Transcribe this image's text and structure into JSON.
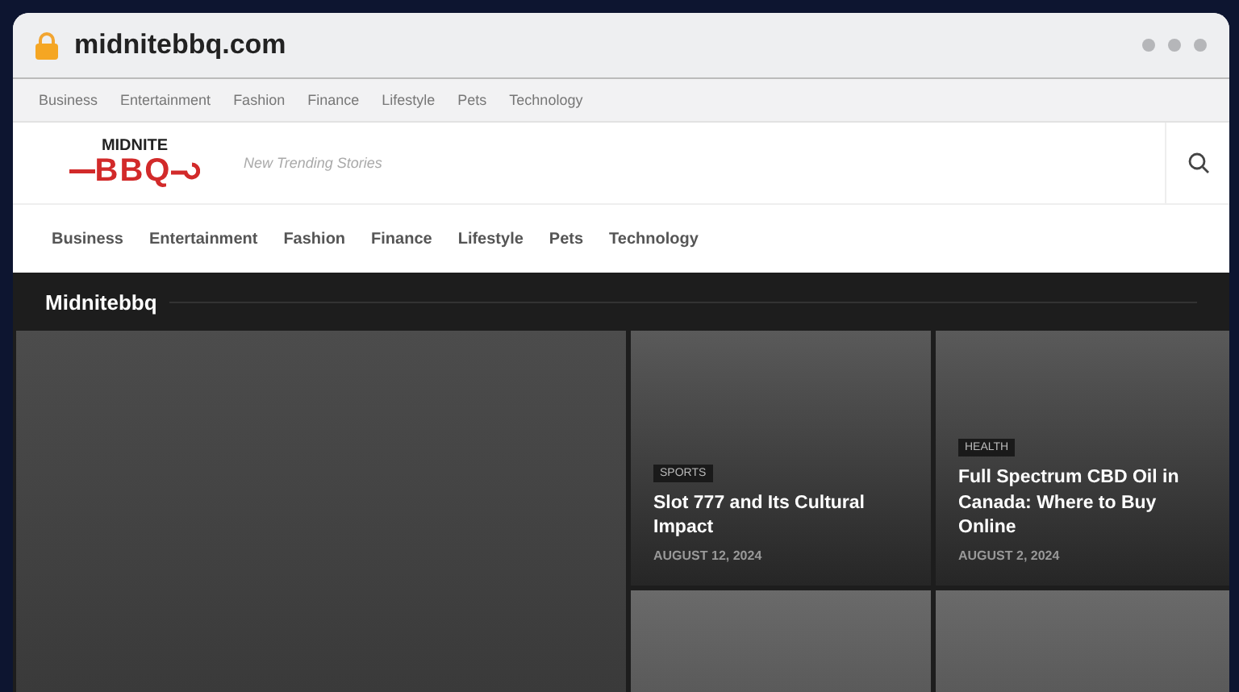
{
  "browser": {
    "address": "midnitebbq.com"
  },
  "top_nav": [
    "Business",
    "Entertainment",
    "Fashion",
    "Finance",
    "Lifestyle",
    "Pets",
    "Technology"
  ],
  "header": {
    "logo_top": "MIDNITE",
    "logo_main": "BBQ",
    "tagline": "New Trending Stories"
  },
  "main_nav": [
    "Business",
    "Entertainment",
    "Fashion",
    "Finance",
    "Lifestyle",
    "Pets",
    "Technology"
  ],
  "section": {
    "title": "Midnitebbq"
  },
  "posts": [
    {
      "category": "SPORTS",
      "title": "Slot 777 and Its Cultural Impact",
      "date": "AUGUST 12, 2024"
    },
    {
      "category": "HEALTH",
      "title": "Full Spectrum CBD Oil in Canada: Where to Buy Online",
      "date": "AUGUST 2, 2024"
    }
  ]
}
